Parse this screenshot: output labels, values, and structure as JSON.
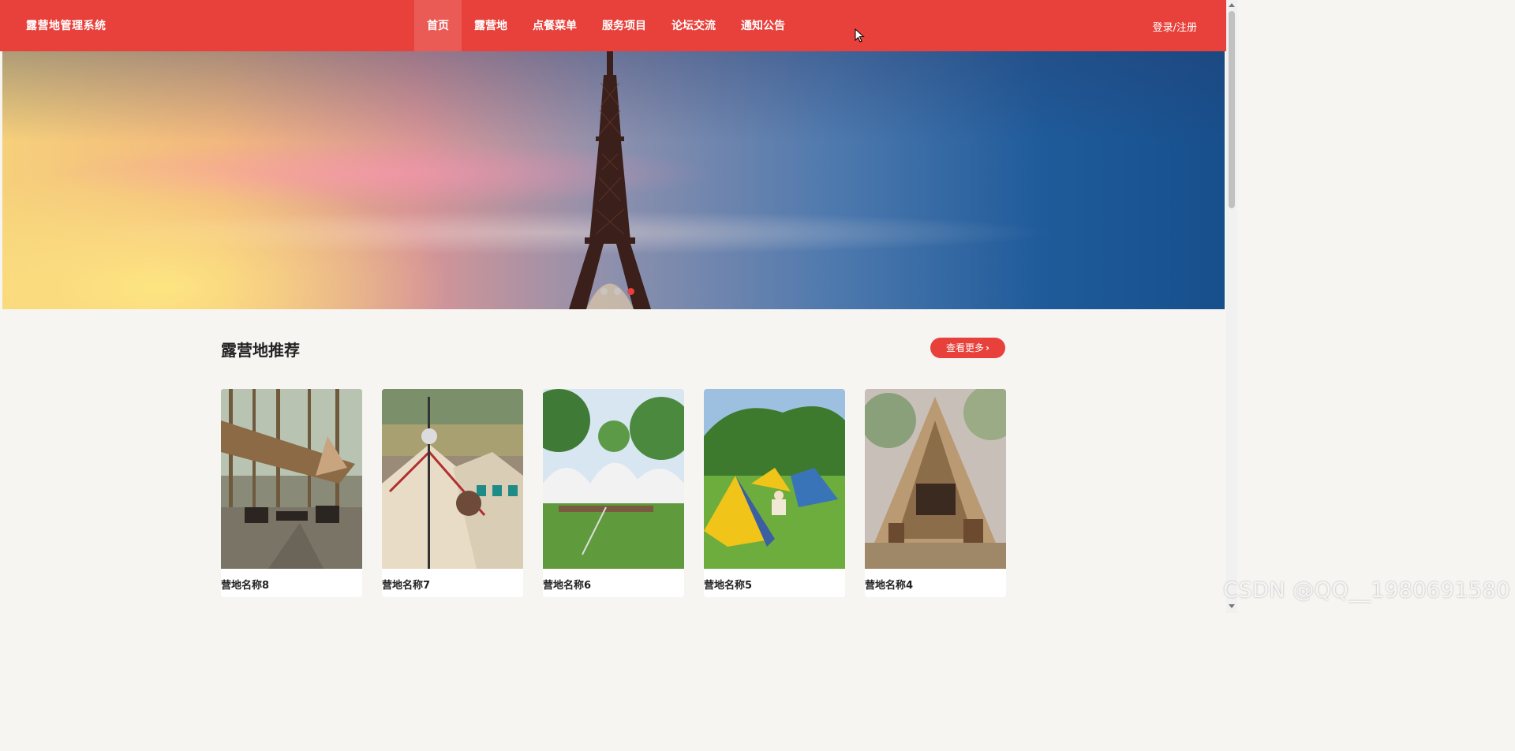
{
  "header": {
    "brand": "露营地管理系统",
    "nav": [
      {
        "label": "首页",
        "active": true
      },
      {
        "label": "露营地",
        "active": false
      },
      {
        "label": "点餐菜单",
        "active": false
      },
      {
        "label": "服务项目",
        "active": false
      },
      {
        "label": "论坛交流",
        "active": false
      },
      {
        "label": "通知公告",
        "active": false
      }
    ],
    "auth_label": "登录/注册"
  },
  "carousel": {
    "slide_count": 3,
    "active_index": 2
  },
  "recommend": {
    "title": "露营地推荐",
    "more_label": "查看更多",
    "items": [
      {
        "name": "营地名称8"
      },
      {
        "name": "营地名称7"
      },
      {
        "name": "营地名称6"
      },
      {
        "name": "营地名称5"
      },
      {
        "name": "营地名称4"
      }
    ]
  },
  "watermark": "CSDN @QQ__1980691580",
  "colors": {
    "primary": "#e8403a",
    "page_bg": "#f6f5f2"
  }
}
